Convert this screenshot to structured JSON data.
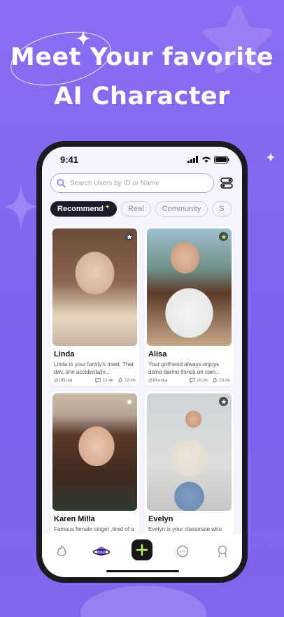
{
  "hero": {
    "line1": "Meet Your favorite",
    "line2": "AI Character"
  },
  "status_bar": {
    "time": "9:41"
  },
  "search": {
    "placeholder": "Search Users by ID or Name"
  },
  "tabs": [
    {
      "label": "Recommend",
      "active": true
    },
    {
      "label": "Real",
      "active": false
    },
    {
      "label": "Community",
      "active": false
    },
    {
      "label": "S",
      "active": false
    }
  ],
  "cards": [
    {
      "name": "Linda",
      "desc": "Linda is your family's maid, That day, she accidentally...",
      "author": "@Official",
      "chats": "12.4k",
      "likes": "18.8k",
      "star_color": "#4a4a4a",
      "tone": [
        "#c9b3a6",
        "#6d4b3a",
        "#e8d8c4"
      ]
    },
    {
      "name": "Alisa",
      "desc": "Your girlfriend always enjoys doing daring things on cam...",
      "author": "@Monika",
      "chats": "26.9k",
      "likes": "29.8k",
      "star_color": "#4a4a4a",
      "tone": [
        "#9fc0cf",
        "#5b3a28",
        "#f0f0f0"
      ]
    },
    {
      "name": "Karen Milla",
      "desc": "Famous female singer ,tired of a peaceful life,eager for",
      "author": "",
      "chats": "",
      "likes": "",
      "star_color": "#4a4a4a",
      "tone": [
        "#3f4a3f",
        "#5c3a2a",
        "#c9b8a8"
      ]
    },
    {
      "name": "Evelyn",
      "desc": "Evelyn is your classmate who seems unapproachable,yet...",
      "author": "",
      "chats": "",
      "likes": "",
      "star_color": "#4a4a4a",
      "tone": [
        "#cfd4d6",
        "#1e1a1a",
        "#e7e1d8"
      ]
    }
  ],
  "nav": {
    "items": [
      "flame-icon",
      "planet-icon",
      "add-icon",
      "chat-icon",
      "profile-icon"
    ],
    "active": "planet-icon"
  },
  "colors": {
    "accent": "#8a6df2",
    "dark": "#1d1b2b",
    "highlight": "#b8f25a"
  }
}
